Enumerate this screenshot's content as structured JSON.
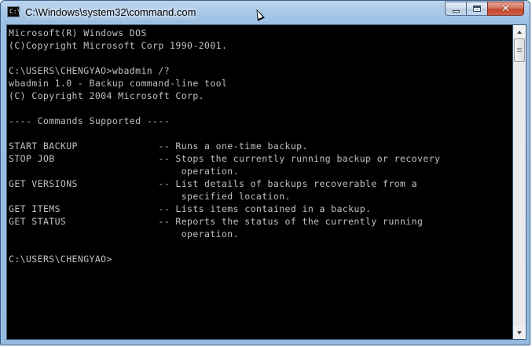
{
  "window": {
    "title": "C:\\Windows\\system32\\command.com",
    "icon": "console-icon",
    "icon_prompt": "C:\\",
    "buttons": {
      "minimize": "minimize-icon",
      "maximize": "maximize-icon",
      "close": "✕"
    }
  },
  "console": {
    "lines": [
      "Microsoft(R) Windows DOS",
      "(C)Copyright Microsoft Corp 1990-2001.",
      "",
      "C:\\USERS\\CHENGYAO>wbadmin /?",
      "wbadmin 1.0 - Backup command-line tool",
      "(C) Copyright 2004 Microsoft Corp.",
      "",
      "---- Commands Supported ----",
      "",
      "START BACKUP              -- Runs a one-time backup.",
      "STOP JOB                  -- Stops the currently running backup or recovery",
      "                              operation.",
      "GET VERSIONS              -- List details of backups recoverable from a",
      "                              specified location.",
      "GET ITEMS                 -- Lists items contained in a backup.",
      "GET STATUS                -- Reports the status of the currently running",
      "                              operation.",
      "",
      "C:\\USERS\\CHENGYAO>"
    ],
    "colors": {
      "background": "#000000",
      "foreground": "#c0c0c0"
    }
  },
  "scrollbar": {
    "up": "scroll-up-icon",
    "down": "scroll-down-icon"
  }
}
